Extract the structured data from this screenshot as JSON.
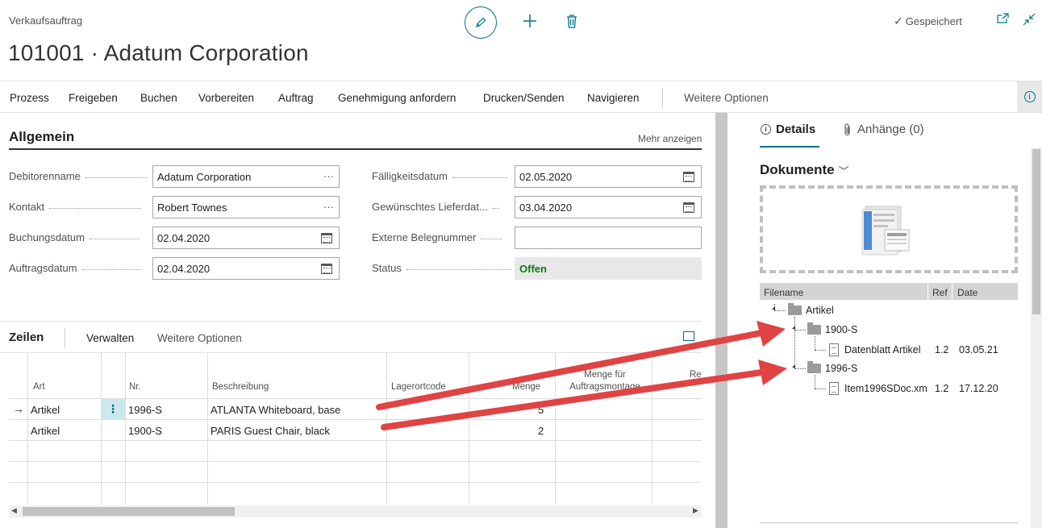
{
  "header": {
    "page_type": "Verkaufsauftrag",
    "title": "101001 · Adatum Corporation",
    "saved": "Gespeichert"
  },
  "actions": {
    "items": [
      "Prozess",
      "Freigeben",
      "Buchen",
      "Vorbereiten",
      "Auftrag",
      "Genehmigung anfordern",
      "Drucken/Senden",
      "Navigieren"
    ],
    "more": "Weitere Optionen"
  },
  "general": {
    "title": "Allgemein",
    "more_link": "Mehr anzeigen",
    "fields": {
      "customer_label": "Debitorenname",
      "customer_value": "Adatum Corporation",
      "contact_label": "Kontakt",
      "contact_value": "Robert Townes",
      "posting_label": "Buchungsdatum",
      "posting_value": "02.04.2020",
      "order_label": "Auftragsdatum",
      "order_value": "02.04.2020",
      "due_label": "Fälligkeitsdatum",
      "due_value": "02.05.2020",
      "delivery_label": "Gewünschtes Lieferdat...",
      "delivery_value": "03.04.2020",
      "extdoc_label": "Externe Belegnummer",
      "extdoc_value": "",
      "status_label": "Status",
      "status_value": "Offen"
    },
    "status_color": "#107c10"
  },
  "lines": {
    "title": "Zeilen",
    "manage": "Verwalten",
    "more": "Weitere Optionen",
    "columns": {
      "art": "Art",
      "nr": "Nr.",
      "desc": "Beschreibung",
      "lagerort": "Lagerortcode",
      "menge": "Menge",
      "menge_auftrag_1": "Menge für",
      "menge_auftrag_2": "Auftragsmontage",
      "re": "Re"
    },
    "rows": [
      {
        "arrow": "→",
        "art": "Artikel",
        "menu": "⋮",
        "nr": "1996-S",
        "desc": "ATLANTA Whiteboard, base",
        "menge": "5"
      },
      {
        "arrow": "",
        "art": "Artikel",
        "menu": "",
        "nr": "1900-S",
        "desc": "PARIS Guest Chair, black",
        "menge": "2"
      }
    ]
  },
  "factbox": {
    "tab_details": "Details",
    "tab_attachments": "Anhänge (0)",
    "documents_title": "Dokumente",
    "tree_headers": {
      "filename": "Filename",
      "ref": "Ref",
      "date": "Date"
    },
    "tree": {
      "root": "Artikel",
      "folder1": "1900-S",
      "file1": {
        "name": "Datenblatt Artikel",
        "ref": "1.2",
        "date": "03.05.21"
      },
      "folder2": "1996-S",
      "file2": {
        "name": "Item1996SDoc.xm",
        "ref": "1.2",
        "date": "17.12.20"
      }
    }
  },
  "annotation": {
    "arrow_color": "#e04343"
  },
  "accent_color": "#00718a"
}
